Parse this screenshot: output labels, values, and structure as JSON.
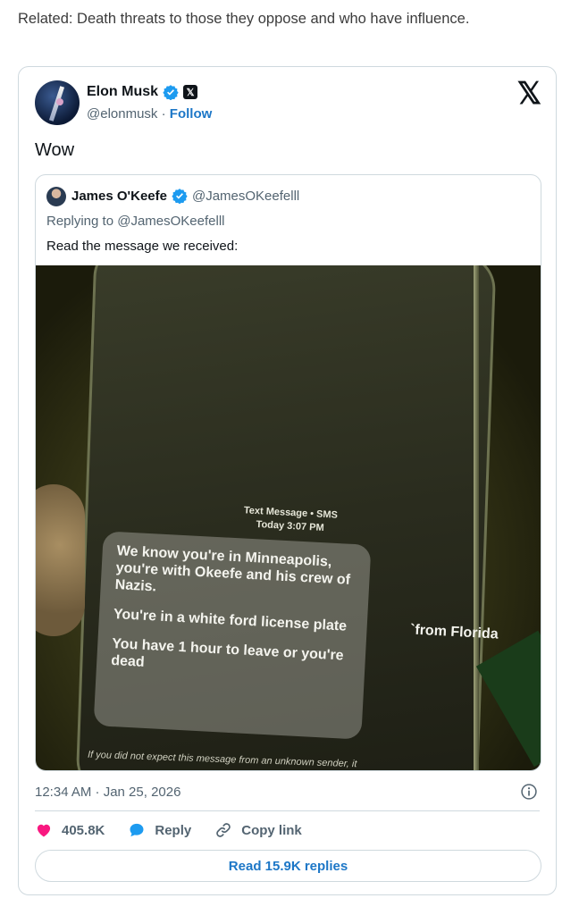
{
  "related_text": "Related: Death threats to those they oppose and who have influence.",
  "tweet": {
    "author_name": "Elon Musk",
    "author_handle": "@elonmusk",
    "separator": "·",
    "follow_label": "Follow",
    "text": "Wow",
    "timestamp": "12:34 AM · Jan 25, 2026",
    "likes": "405.8K",
    "reply_label": "Reply",
    "copy_link_label": "Copy link",
    "read_replies_label": "Read 15.9K replies"
  },
  "quoted": {
    "author_name": "James O'Keefe",
    "author_handle": "@JamesOKeefelll",
    "replying_to": "Replying to @JamesOKeefelll",
    "text": "Read the message we received:"
  },
  "image": {
    "sms_header_line1": "Text Message • SMS",
    "sms_header_line2": "Today 3:07 PM",
    "message_p1": "We know you're in Minneapolis, you're with Okeefe and his crew of Nazis.",
    "message_p2": "You're in a white ford license plate                `from Florida",
    "message_p3": "You have 1 hour to leave or you're dead",
    "warning": "If you did not expect this message from an unknown sender, it"
  },
  "colors": {
    "accent": "#1d77c7",
    "verified": "#1d9bf0",
    "like": "#f91880",
    "reply": "#1d9bf0"
  },
  "icons": [
    "verified-badge-icon",
    "x-badge-icon",
    "x-logo-icon",
    "info-icon",
    "heart-icon",
    "reply-bubble-icon",
    "link-icon"
  ]
}
